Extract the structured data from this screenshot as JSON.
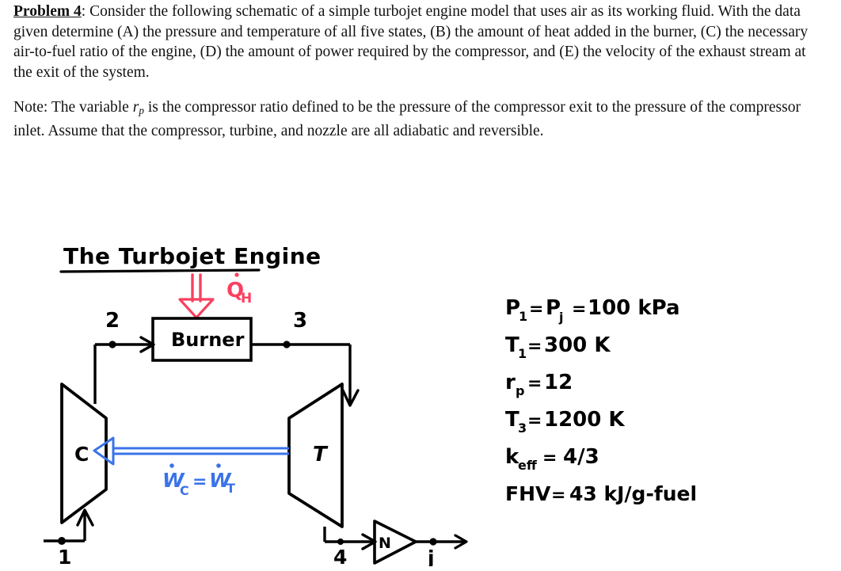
{
  "problem": {
    "label": "Problem 4",
    "label_sep": ":",
    "paragraph1_part1": " Consider the following schematic of a simple turbojet engine model that uses air as its working fluid. With the data given determine (A) the pressure and temperature of all five states, (B) the amount of heat added in the burner, (C) the necessary air-to-fuel ratio of the engine, (D) the amount of power required by the compressor, and (E) the velocity of the exhaust stream at the exit of the system.",
    "note_prefix": "Note: The variable ",
    "note_var": "r",
    "note_var_sub": "p",
    "note_suffix": " is the compressor ratio defined to be the pressure of the compressor exit to the pressure of the compressor inlet. Assume that the compressor, turbine, and nozzle are all adiabatic and reversible."
  },
  "diagram": {
    "title": "The Turbojet Engine",
    "burner_label": "Burner",
    "compressor_label": "C",
    "turbine_label": "T",
    "nozzle_label": "N",
    "heat_label": "Q",
    "heat_label_sub": "H",
    "work_label_left": "W",
    "work_label_left_sub": "C",
    "work_label_eq": "=",
    "work_label_right": "W",
    "work_label_right_sub": "T",
    "state_1": "1",
    "state_2": "2",
    "state_3": "3",
    "state_4": "4",
    "state_j": "j",
    "colors": {
      "ink": "#000000",
      "heat_arrow": "#fa4060",
      "shaft": "#3b73e8"
    }
  },
  "given": {
    "lines": [
      {
        "lhs": "P",
        "lhs_sub": "1",
        "eq1": "=",
        "mid": "P",
        "mid_sub": "j",
        "eq2": "=",
        "rhs": "100 kPa"
      },
      {
        "lhs": "T",
        "lhs_sub": "1",
        "eq1": "=",
        "mid": "",
        "mid_sub": "",
        "eq2": "",
        "rhs": "300 K"
      },
      {
        "lhs": "r",
        "lhs_sub": "p",
        "eq1": "=",
        "mid": "",
        "mid_sub": "",
        "eq2": "",
        "rhs": "12"
      },
      {
        "lhs": "T",
        "lhs_sub": "3",
        "eq1": "=",
        "mid": "",
        "mid_sub": "",
        "eq2": "",
        "rhs": "1200 K"
      },
      {
        "lhs": "k",
        "lhs_sub": "eff",
        "eq1": "=",
        "mid": "",
        "mid_sub": "",
        "eq2": "",
        "rhs": "4/3"
      },
      {
        "lhs": "FHV",
        "lhs_sub": "",
        "eq1": "=",
        "mid": "",
        "mid_sub": "",
        "eq2": "",
        "rhs": "43 kJ/g-fuel"
      }
    ]
  }
}
